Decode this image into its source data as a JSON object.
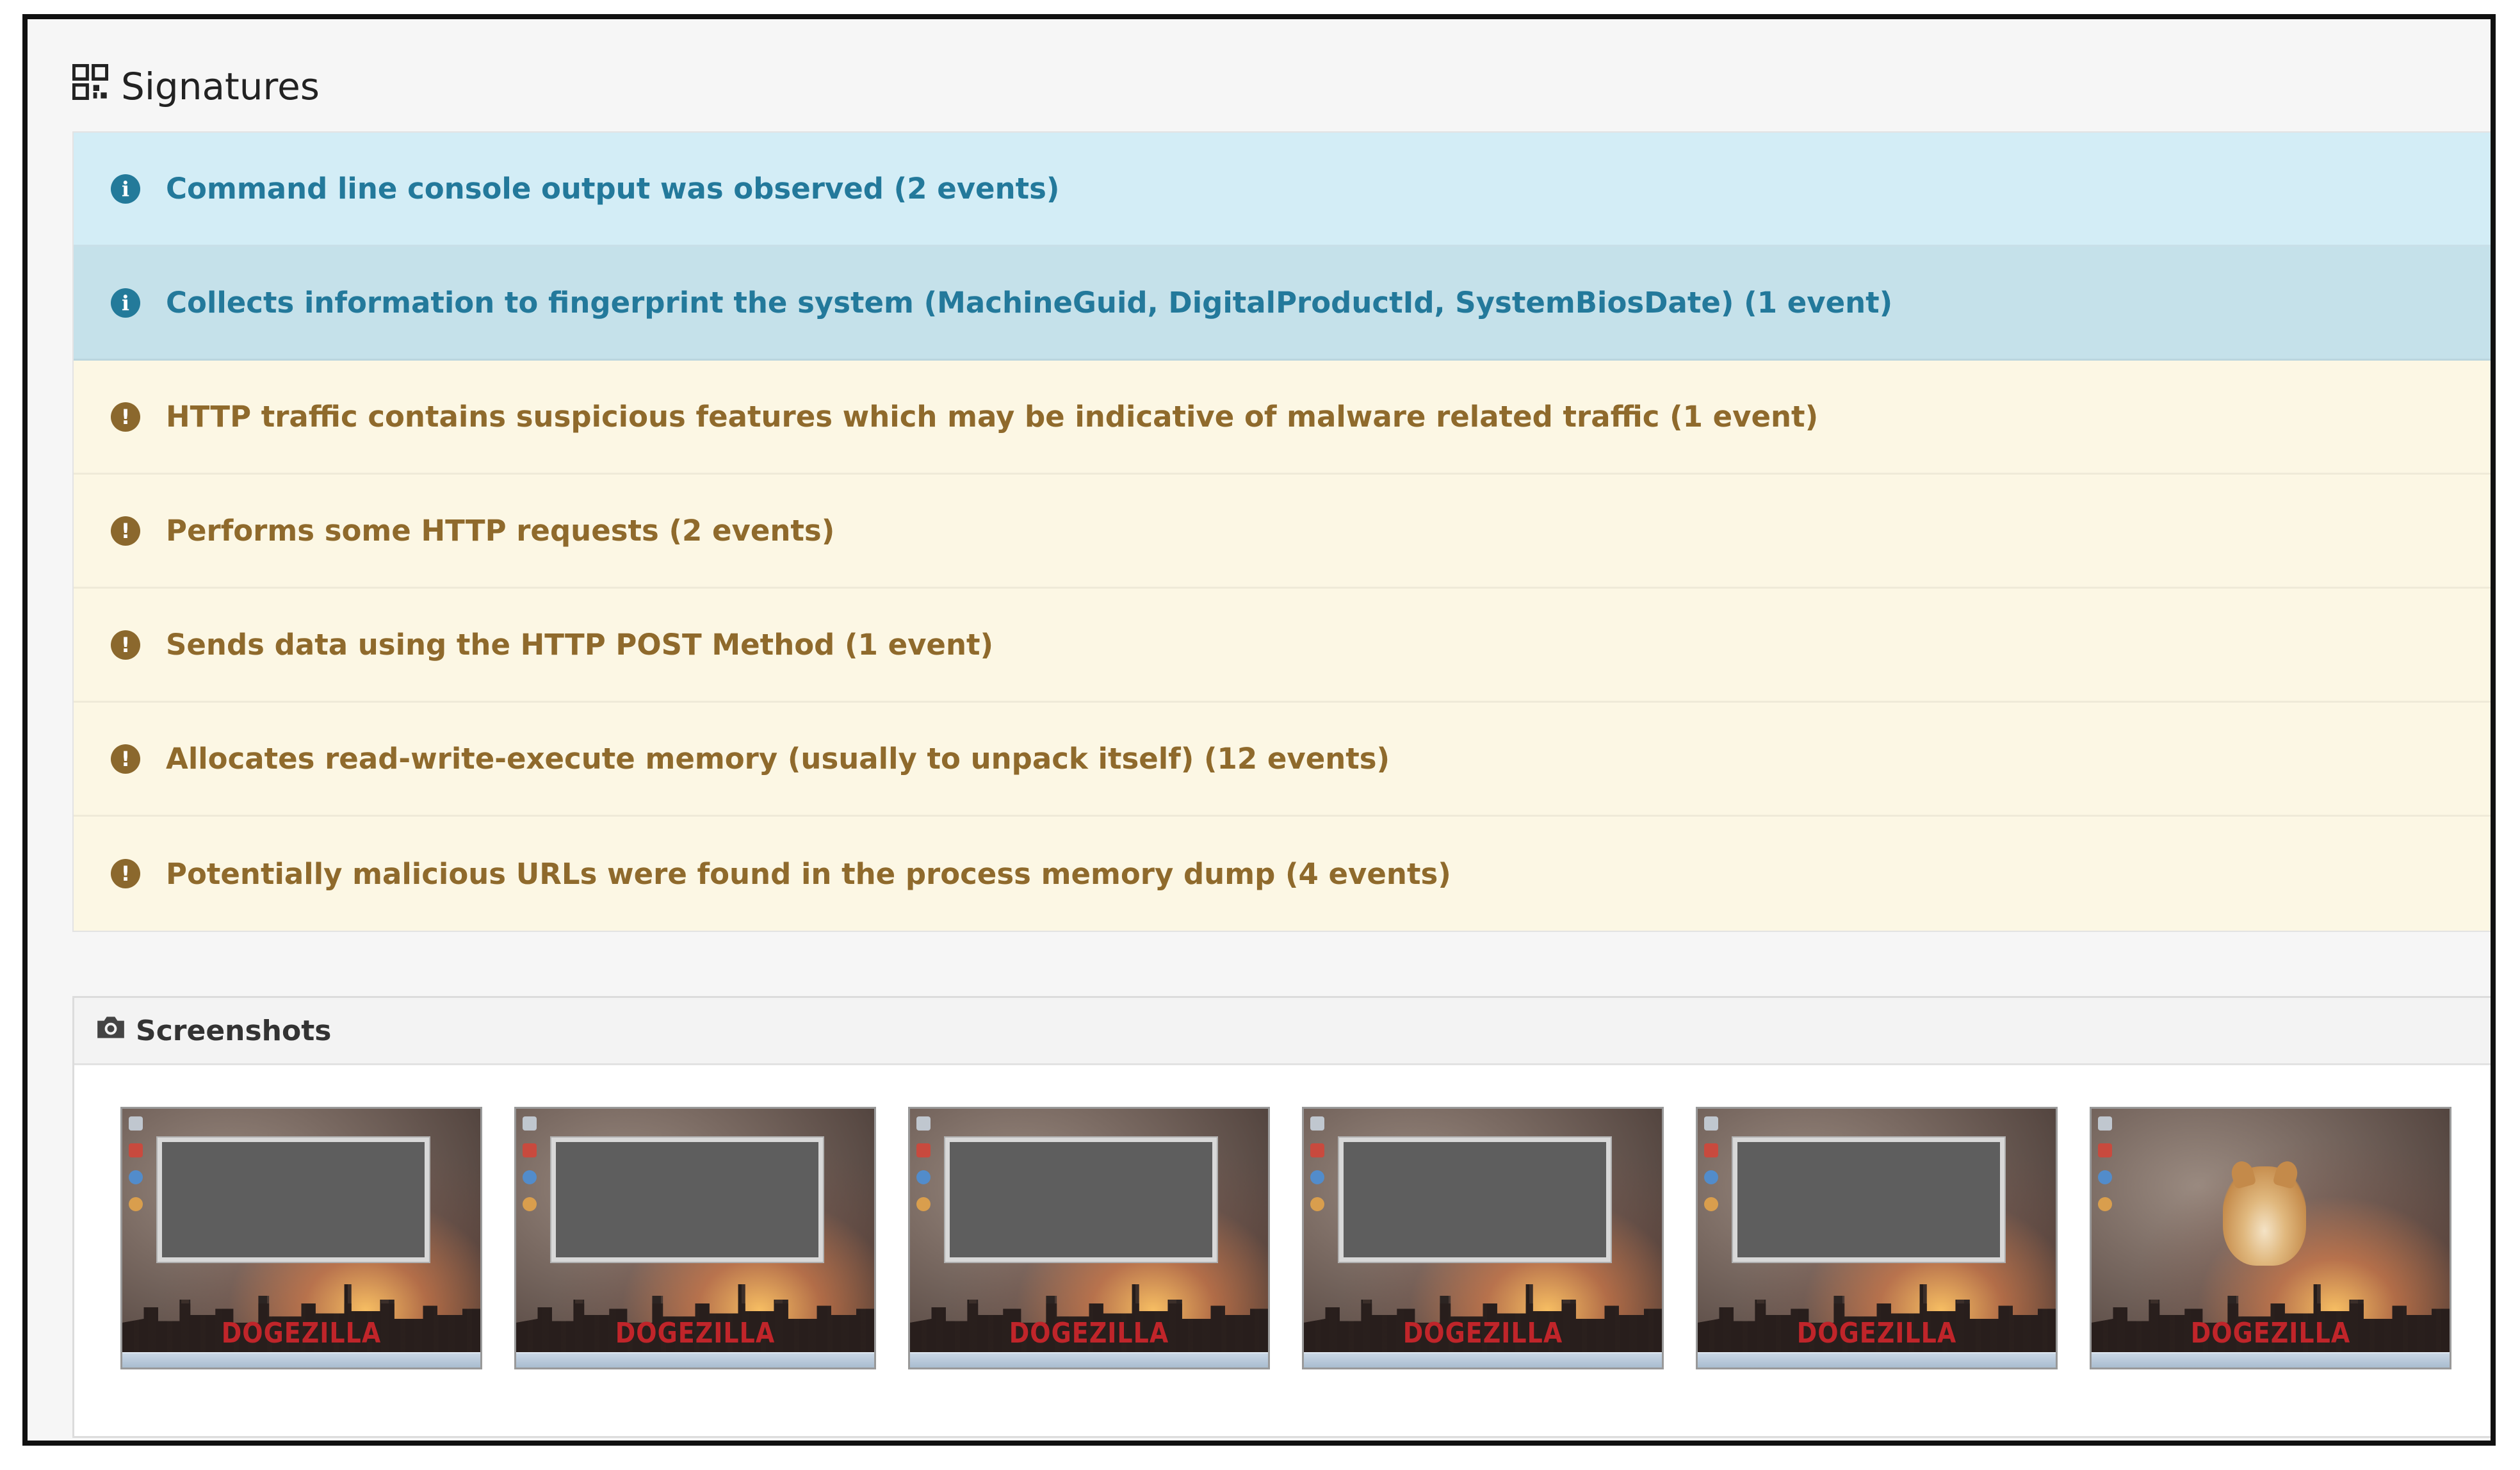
{
  "signatures": {
    "title": "Signatures",
    "items": [
      {
        "text": "Command line console output was observed (2 events)",
        "severity": "info"
      },
      {
        "text": "Collects information to fingerprint the system (MachineGuid, DigitalProductId, SystemBiosDate) (1 event)",
        "severity": "info"
      },
      {
        "text": "HTTP traffic contains suspicious features which may be indicative of malware related traffic (1 event)",
        "severity": "warning"
      },
      {
        "text": "Performs some HTTP requests (2 events)",
        "severity": "warning"
      },
      {
        "text": "Sends data using the HTTP POST Method (1 event)",
        "severity": "warning"
      },
      {
        "text": "Allocates read-write-execute memory (usually to unpack itself) (12 events)",
        "severity": "warning"
      },
      {
        "text": "Potentially malicious URLs were found in the process memory dump (4 events)",
        "severity": "warning"
      }
    ]
  },
  "screenshots": {
    "title": "Screenshots",
    "thumbnails": [
      {
        "caption": "DOGEZILLA"
      },
      {
        "caption": "DOGEZILLA"
      },
      {
        "caption": "DOGEZILLA"
      },
      {
        "caption": "DOGEZILLA"
      },
      {
        "caption": "DOGEZILLA"
      },
      {
        "caption": "DOGEZILLA"
      }
    ]
  },
  "colors": {
    "info_bg": "#d3edf6",
    "info_text": "#23799b",
    "warning_bg": "#fcf7e4",
    "warning_text": "#8f6a2c"
  },
  "icons": {
    "signatures": "grid-icon",
    "info": "info-circle-icon",
    "warning": "exclamation-circle-icon",
    "screenshots": "camera-icon"
  }
}
